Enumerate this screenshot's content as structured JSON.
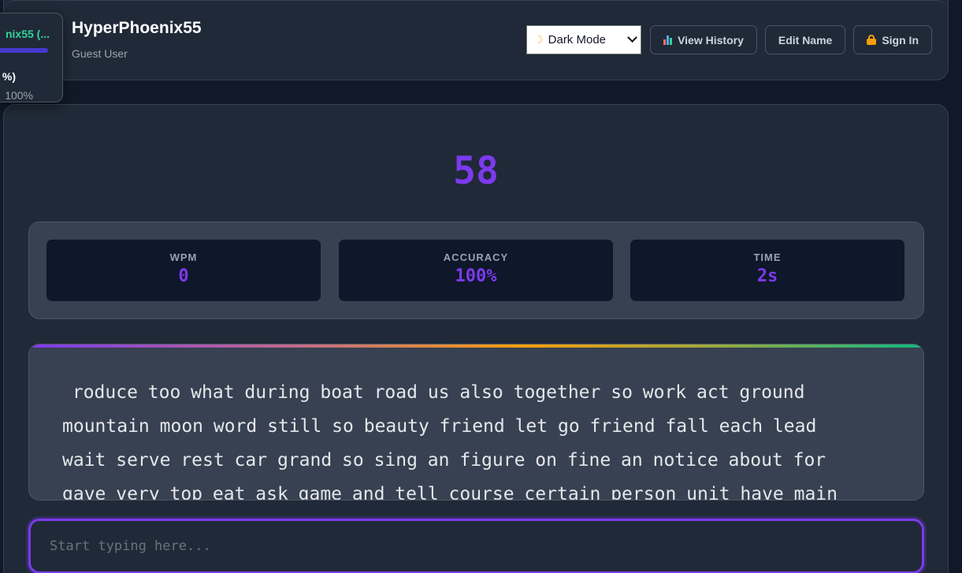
{
  "header": {
    "user_name": "HyperPhoenix55",
    "user_role": "Guest User",
    "theme_select": {
      "selected": "Dark Mode",
      "icon": "moon-icon"
    },
    "buttons": {
      "view_history": "View History",
      "edit_name": "Edit Name",
      "sign_in": "Sign In"
    }
  },
  "mini_leaderboard": {
    "name": "nix55 (...",
    "progress_fraction": 1.0,
    "percent_text": "%)",
    "accuracy_text": "100%"
  },
  "test": {
    "timer_value": "58",
    "stats": [
      {
        "label": "WPM",
        "value": "0"
      },
      {
        "label": "ACCURACY",
        "value": "100%"
      },
      {
        "label": "TIME",
        "value": "2s"
      }
    ],
    "passage_lines": [
      " roduce too what during boat road us also together so work act ground",
      "mountain moon word still so beauty friend let go friend fall each lead",
      "wait serve rest car grand so sing an figure on fine an notice about for",
      "gave very top eat ask game and tell course certain person unit have main"
    ],
    "input_placeholder": "Start typing here..."
  },
  "colors": {
    "accent": "#7c3aed",
    "background": "#111827",
    "card": "#1f2937",
    "leader_name": "#34d399"
  }
}
